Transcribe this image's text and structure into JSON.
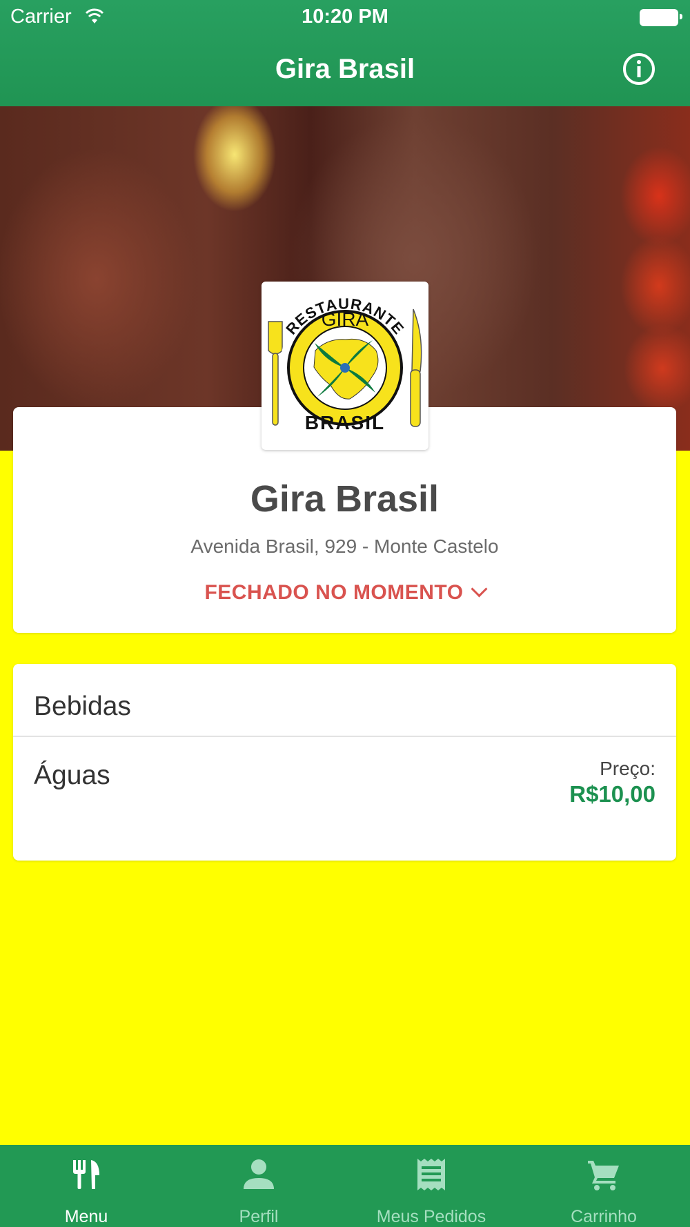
{
  "status_bar": {
    "carrier": "Carrier",
    "time": "10:20 PM"
  },
  "nav": {
    "title": "Gira Brasil",
    "info_icon": "info-icon"
  },
  "logo": {
    "top_text": "RESTAURANTE",
    "middle_text": "GIRA",
    "bottom_text": "BRASIL"
  },
  "restaurant": {
    "name": "Gira Brasil",
    "address": "Avenida Brasil, 929 - Monte Castelo",
    "status": "FECHADO NO MOMENTO"
  },
  "menu": {
    "category": "Bebidas",
    "items": [
      {
        "name": "Águas",
        "price_label": "Preço:",
        "price": "R$10,00"
      }
    ]
  },
  "tabs": [
    {
      "label": "Menu",
      "icon": "fork-knife-icon",
      "active": true
    },
    {
      "label": "Perfil",
      "icon": "person-icon",
      "active": false
    },
    {
      "label": "Meus Pedidos",
      "icon": "receipt-icon",
      "active": false
    },
    {
      "label": "Carrinho",
      "icon": "cart-icon",
      "active": false
    }
  ],
  "colors": {
    "brand_green": "#229954",
    "background_yellow": "#ffff00",
    "status_red": "#d9534f",
    "price_green": "#1c9150",
    "tab_inactive": "#a5dfc0"
  }
}
